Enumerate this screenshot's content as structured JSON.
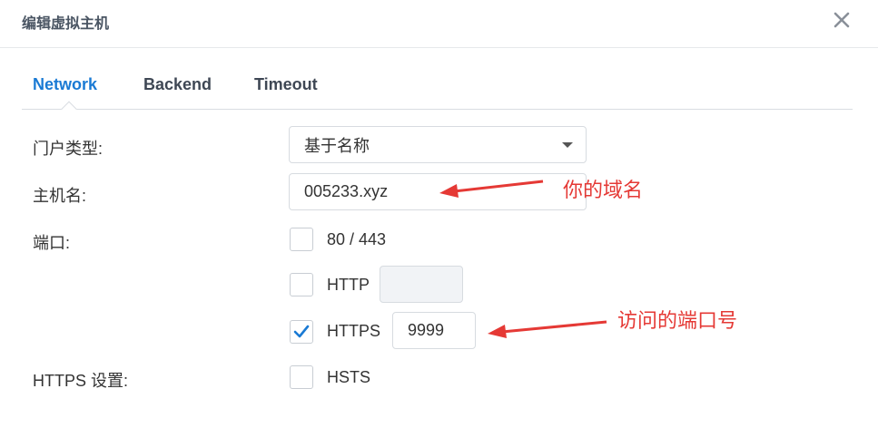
{
  "dialog": {
    "title": "编辑虚拟主机"
  },
  "tabs": [
    {
      "label": "Network",
      "active": true
    },
    {
      "label": "Backend",
      "active": false
    },
    {
      "label": "Timeout",
      "active": false
    }
  ],
  "form": {
    "portal_type": {
      "label": "门户类型:",
      "value": "基于名称"
    },
    "hostname": {
      "label": "主机名:",
      "value": "005233.xyz"
    },
    "port": {
      "label": "端口:",
      "options": [
        {
          "label": "80 / 443",
          "checked": false
        },
        {
          "label": "HTTP",
          "checked": false,
          "value": ""
        },
        {
          "label": "HTTPS",
          "checked": true,
          "value": "9999"
        }
      ]
    },
    "https_settings": {
      "label": "HTTPS 设置:",
      "option": {
        "label": "HSTS",
        "checked": false
      }
    }
  },
  "annotations": {
    "hostname_note": "你的域名",
    "port_note": "访问的端口号"
  },
  "colors": {
    "accent": "#1a7ad4",
    "annotation": "#e53935"
  }
}
